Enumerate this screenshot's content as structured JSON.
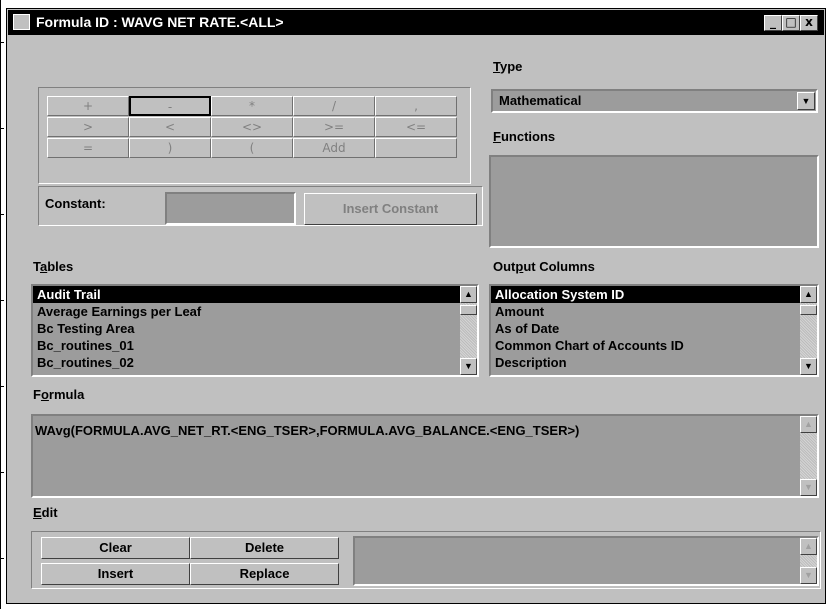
{
  "window": {
    "title": "Formula ID : WAVG NET RATE.<ALL>",
    "min_symbol": "_",
    "max_symbol": "□",
    "close_symbol": "x"
  },
  "operators": {
    "row1": [
      "+",
      "-",
      "*",
      "/",
      ","
    ],
    "row2": [
      ">",
      "<",
      "<>",
      ">=",
      "<="
    ],
    "row3": [
      "=",
      ")",
      "(",
      "Add",
      ""
    ]
  },
  "constant": {
    "label": "Constant:",
    "value": "",
    "insert_button": "Insert Constant"
  },
  "type": {
    "label": "Type",
    "selected": "Mathematical"
  },
  "functions": {
    "label": "Functions",
    "items": []
  },
  "tables": {
    "label": "Tables",
    "items": [
      "Audit Trail",
      "Average Earnings per Leaf",
      "Bc Testing Area",
      "Bc_routines_01",
      "Bc_routines_02"
    ],
    "selected_index": 0
  },
  "output_columns": {
    "label": "Output Columns",
    "items": [
      "Allocation System ID",
      "Amount",
      "As of Date",
      "Common Chart of Accounts ID",
      "Description"
    ],
    "selected_index": 0
  },
  "formula": {
    "label": "Formula",
    "text": "WAvg(FORMULA.AVG_NET_RT.<ENG_TSER>,FORMULA.AVG_BALANCE.<ENG_TSER>)"
  },
  "edit": {
    "label": "Edit",
    "clear": "Clear",
    "delete": "Delete",
    "insert": "Insert",
    "replace": "Replace",
    "text": ""
  },
  "icons": {
    "scroll_up": "▲",
    "scroll_down": "▼",
    "dropdown": "▼"
  }
}
